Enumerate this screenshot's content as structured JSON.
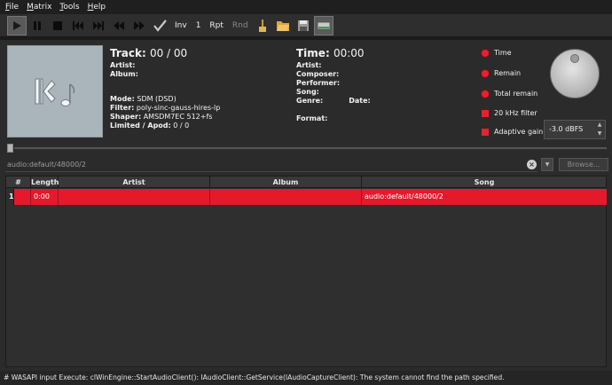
{
  "menu": [
    {
      "accel": "F",
      "rest": "ile"
    },
    {
      "accel": "M",
      "rest": "atrix"
    },
    {
      "accel": "T",
      "rest": "ools"
    },
    {
      "accel": "H",
      "rest": "elp"
    }
  ],
  "toolbar": {
    "icons": [
      "play-icon",
      "pause-icon",
      "stop-icon",
      "previous-track-icon",
      "next-track-icon",
      "rewind-icon",
      "fast-forward-icon",
      "checkmark-icon"
    ],
    "inv_label": "Inv",
    "repeat_count": "1",
    "rpt_label": "Rpt",
    "rnd_label": "Rnd",
    "right_icons": [
      "brush-icon",
      "open-folder-icon",
      "save-disk-icon",
      "drive-icon"
    ]
  },
  "track": {
    "title_label": "Track:",
    "title_value": "00 / 00",
    "artist_label": "Artist:",
    "album_label": "Album:",
    "mode_label": "Mode:",
    "mode_value": "SDM (DSD)",
    "filter_label": "Filter:",
    "filter_value": "poly-sinc-gauss-hires-lp",
    "shaper_label": "Shaper:",
    "shaper_value": "AMSDM7EC 512+fs",
    "limited_label": "Limited / Apod:",
    "limited_value": "0 / 0"
  },
  "time": {
    "title_label": "Time:",
    "title_value": "00:00",
    "artist_label": "Artist:",
    "composer_label": "Composer:",
    "performer_label": "Performer:",
    "song_label": "Song:",
    "genre_label": "Genre:",
    "date_label": "Date:",
    "format_label": "Format:"
  },
  "options": {
    "time": "Time",
    "remain": "Remain",
    "total_remain": "Total remain",
    "filter_20k": "20 kHz filter",
    "adaptive_gain": "Adaptive gain"
  },
  "volume": {
    "value": "-3.0 dBFS"
  },
  "path": {
    "value": "audio:default/48000/2",
    "browse_label": "Browse..."
  },
  "playlist": {
    "columns": [
      "#",
      "Length",
      "Artist",
      "Album",
      "Song"
    ],
    "rows": [
      {
        "index": "1",
        "length": "0:00",
        "artist": "",
        "album": "",
        "song": "audio:default/48000/2"
      }
    ]
  },
  "status": "# WASAPI input Execute: clWinEngine::StartAudioClient(): IAudioClient::GetService(IAudioCaptureClient): The system cannot find the path specified.",
  "colors": {
    "accent": "#e5192c",
    "background": "#2b2b2b"
  }
}
